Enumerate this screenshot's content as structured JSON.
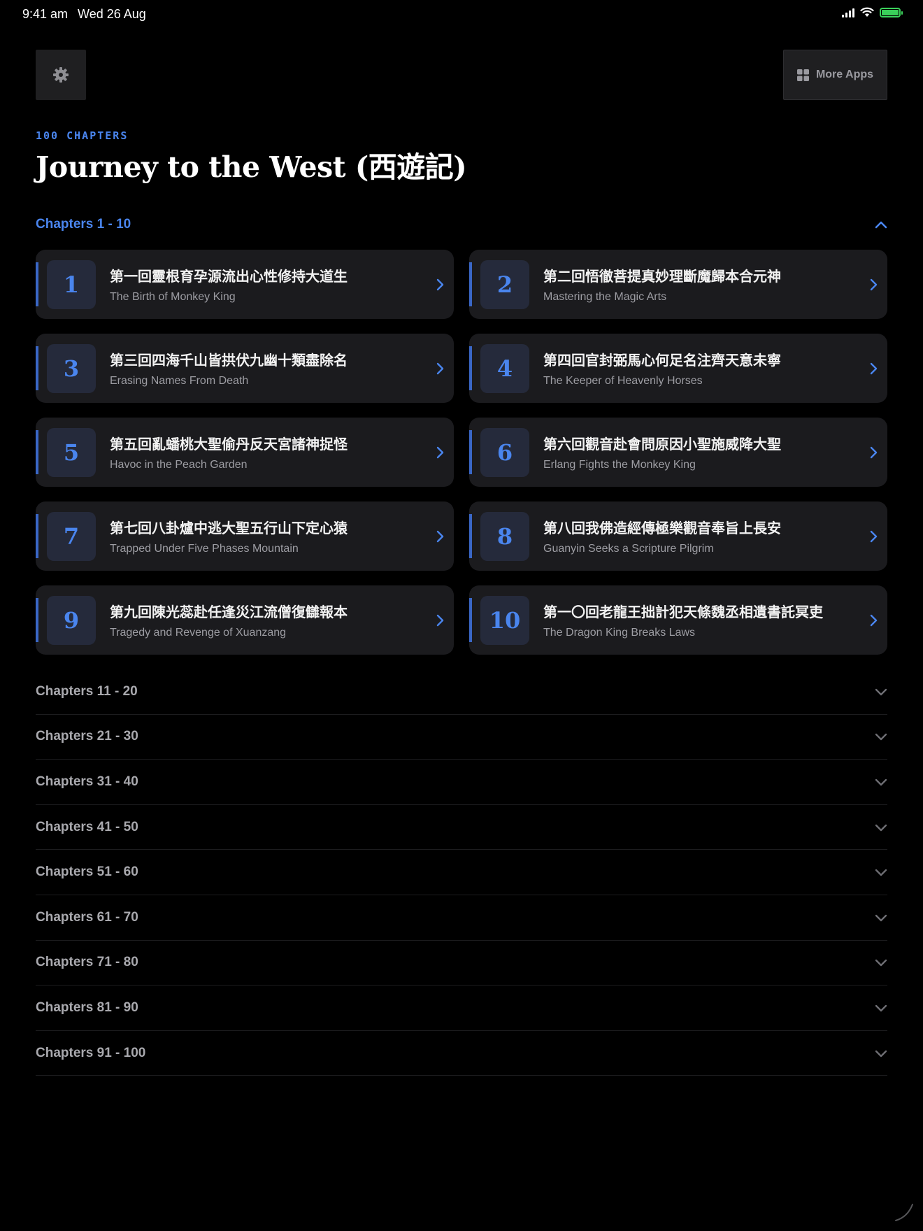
{
  "status_bar": {
    "time": "9:41 am",
    "date": "Wed 26 Aug"
  },
  "header": {
    "settings_icon": "gear-icon",
    "more_apps_label": "More Apps",
    "more_apps_icon": "grid-icon"
  },
  "book": {
    "count_label": "100 CHAPTERS",
    "title": "Journey to the West (西遊記)"
  },
  "open_group": {
    "title": "Chapters 1 - 10",
    "chapters": [
      {
        "num": "1",
        "cn": "第一回靈根育孕源流出心性修持大道生",
        "en": "The Birth of Monkey King"
      },
      {
        "num": "2",
        "cn": "第二回悟徹菩提真妙理斷魔歸本合元神",
        "en": "Mastering the Magic Arts"
      },
      {
        "num": "3",
        "cn": "第三回四海千山皆拱伏九幽十類盡除名",
        "en": "Erasing Names From Death"
      },
      {
        "num": "4",
        "cn": "第四回官封弼馬心何足名注齊天意未寧",
        "en": "The Keeper of Heavenly Horses"
      },
      {
        "num": "5",
        "cn": "第五回亂蟠桃大聖偷丹反天宮諸神捉怪",
        "en": "Havoc in the Peach Garden"
      },
      {
        "num": "6",
        "cn": "第六回觀音赴會問原因小聖施威降大聖",
        "en": "Erlang Fights the Monkey King"
      },
      {
        "num": "7",
        "cn": "第七回八卦爐中逃大聖五行山下定心猿",
        "en": "Trapped Under Five Phases Mountain"
      },
      {
        "num": "8",
        "cn": "第八回我佛造經傳極樂觀音奉旨上長安",
        "en": "Guanyin Seeks a Scripture Pilgrim"
      },
      {
        "num": "9",
        "cn": "第九回陳光蕊赴任逢災江流僧復讎報本",
        "en": "Tragedy and Revenge of Xuanzang"
      },
      {
        "num": "10",
        "cn": "第一〇回老龍王拙計犯天條魏丞相遺書託冥吏",
        "en": "The Dragon King Breaks Laws"
      }
    ]
  },
  "collapsed_groups": [
    "Chapters 11 - 20",
    "Chapters 21 - 30",
    "Chapters 31 - 40",
    "Chapters 41 - 50",
    "Chapters 51 - 60",
    "Chapters 61 - 70",
    "Chapters 71 - 80",
    "Chapters 81 - 90",
    "Chapters 91 - 100"
  ],
  "colors": {
    "accent": "#4a85ee",
    "background": "#000000",
    "card": "#1b1b1e",
    "battery": "#3ad05a"
  }
}
